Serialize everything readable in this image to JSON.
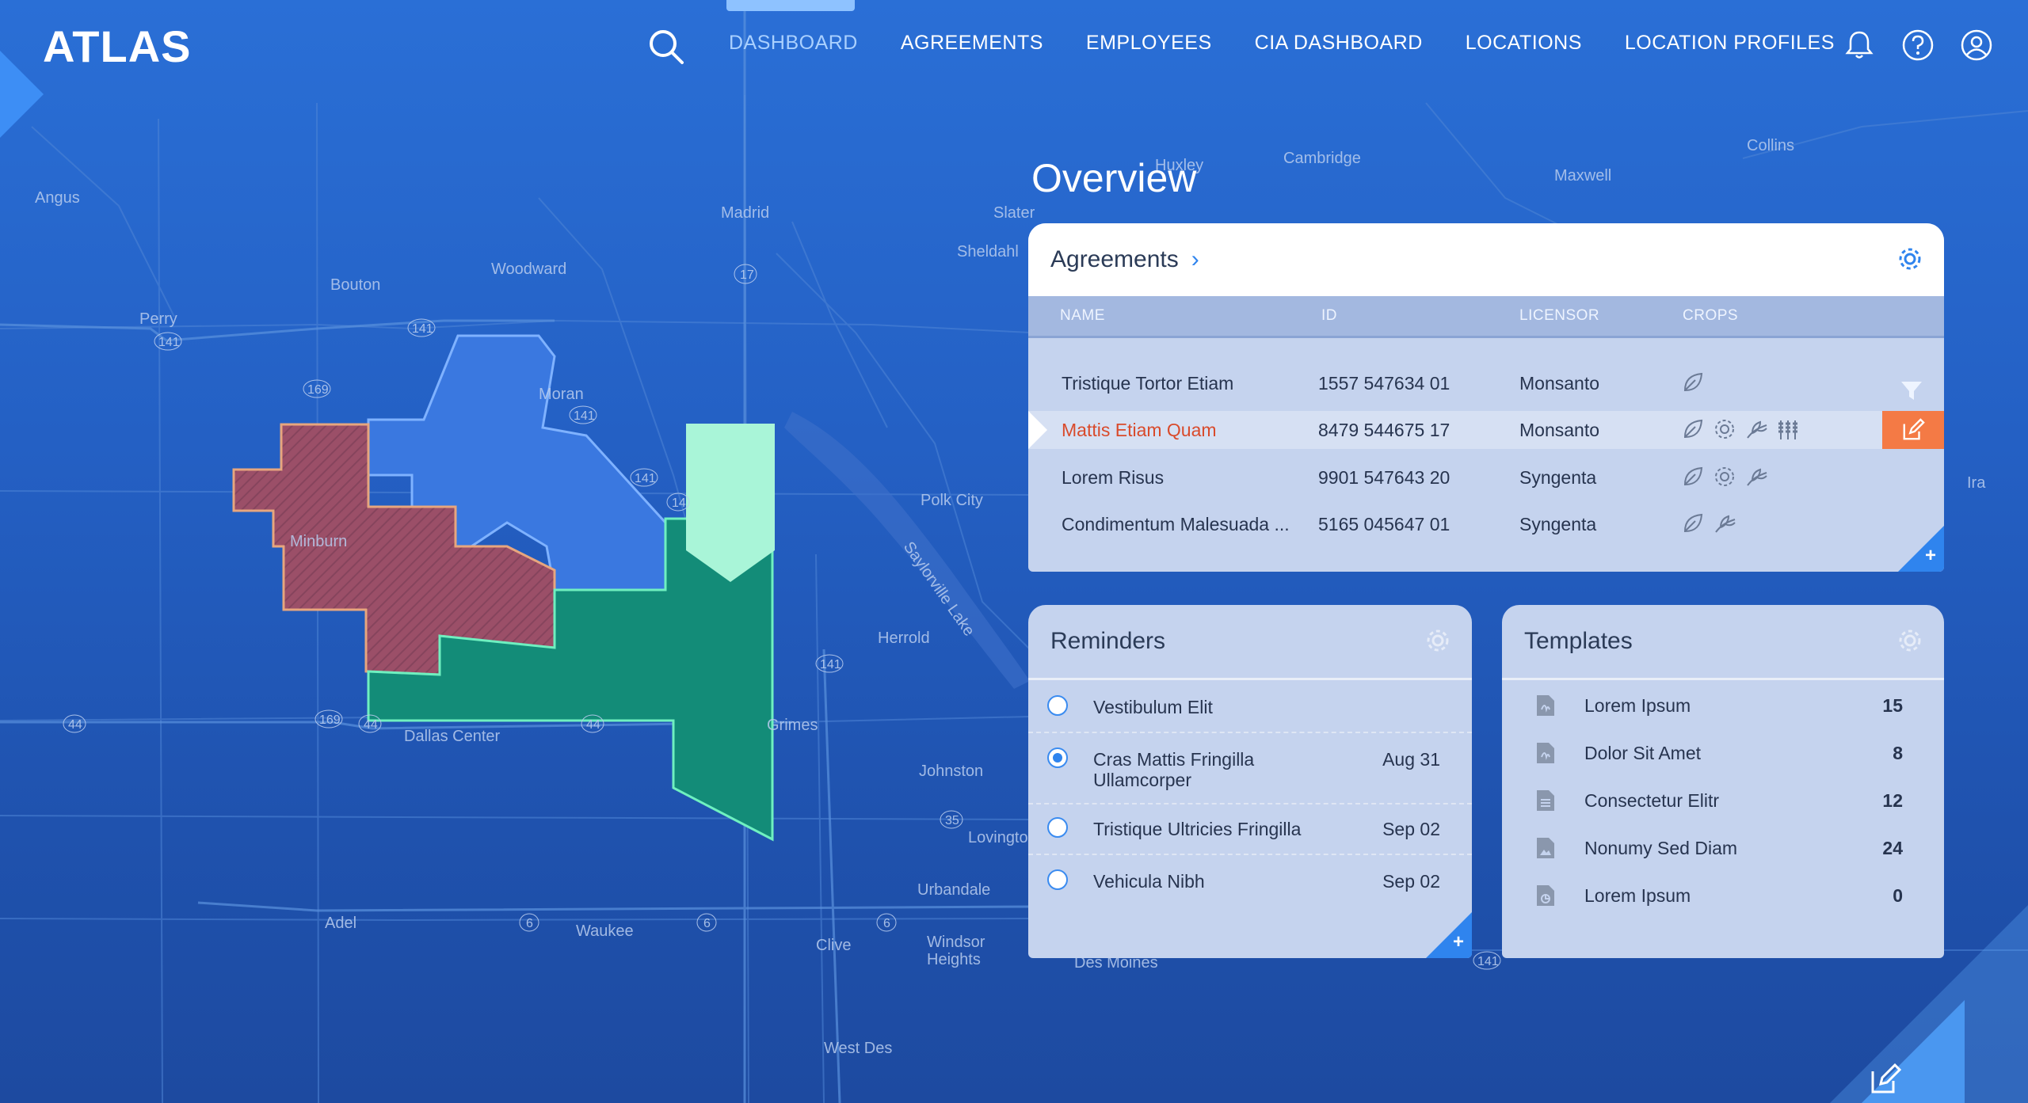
{
  "header": {
    "logo": "ATLAS",
    "nav": [
      "DASHBOARD",
      "AGREEMENTS",
      "EMPLOYEES",
      "CIA DASHBOARD",
      "LOCATIONS",
      "LOCATION PROFILES"
    ],
    "active_nav": "DASHBOARD"
  },
  "map": {
    "places": [
      "Angus",
      "Bouton",
      "Woodward",
      "Perry",
      "Madrid",
      "Slater",
      "Sheldahl",
      "Moran",
      "Minburn",
      "Polk City",
      "Herrold",
      "Dallas Center",
      "Grimes",
      "Johnston",
      "Adel",
      "Waukee",
      "Urbandale",
      "Clive",
      "Windsor Heights",
      "West Des Moines",
      "Des Moines",
      "Huxley",
      "Cambridge",
      "Maxwell",
      "Collins",
      "Ira",
      "Saylorville Lake",
      "Lovington"
    ],
    "highway_labels": [
      "141",
      "141",
      "141",
      "141",
      "17",
      "169",
      "169",
      "44",
      "44",
      "44",
      "141",
      "35",
      "6",
      "6",
      "6",
      "141",
      "14"
    ]
  },
  "overview_title": "Overview",
  "agreements": {
    "title": "Agreements",
    "columns": [
      "NAME",
      "ID",
      "LICENSOR",
      "CROPS"
    ],
    "rows": [
      {
        "name": "Tristique Tortor Etiam",
        "id": "1557 547634 01",
        "licensor": "Monsanto"
      },
      {
        "name": "Mattis Etiam Quam",
        "id": "8479 544675 17",
        "licensor": "Monsanto"
      },
      {
        "name": "Lorem Risus",
        "id": "9901 547643 20",
        "licensor": "Syngenta"
      },
      {
        "name": "Condimentum Malesuada ...",
        "id": "5165 045647 01",
        "licensor": "Syngenta"
      }
    ]
  },
  "reminders": {
    "title": "Reminders",
    "items": [
      {
        "text": "Vestibulum Elit",
        "date": ""
      },
      {
        "text": "Cras Mattis Fringilla",
        "text2": "Ullamcorper",
        "date": "Aug 31"
      },
      {
        "text": "Tristique Ultricies Fringilla",
        "date": "Sep 02"
      },
      {
        "text": "Vehicula Nibh",
        "date": "Sep 02"
      }
    ]
  },
  "templates": {
    "title": "Templates",
    "items": [
      {
        "name": "Lorem Ipsum",
        "count": "15"
      },
      {
        "name": "Dolor Sit Amet",
        "count": "8"
      },
      {
        "name": "Consectetur Elitr",
        "count": "12"
      },
      {
        "name": "Nonumy Sed Diam",
        "count": "24"
      },
      {
        "name": "Lorem Ipsum",
        "count": "0"
      }
    ]
  },
  "colors": {
    "accent": "#2f84ee",
    "selected_row_text": "#d94a2b",
    "edit_button": "#f47a45",
    "map_region_red": "#a05a6a",
    "map_region_blue": "#3a78e0",
    "map_region_green": "#138c78",
    "map_marker": "#a9f5d8"
  }
}
